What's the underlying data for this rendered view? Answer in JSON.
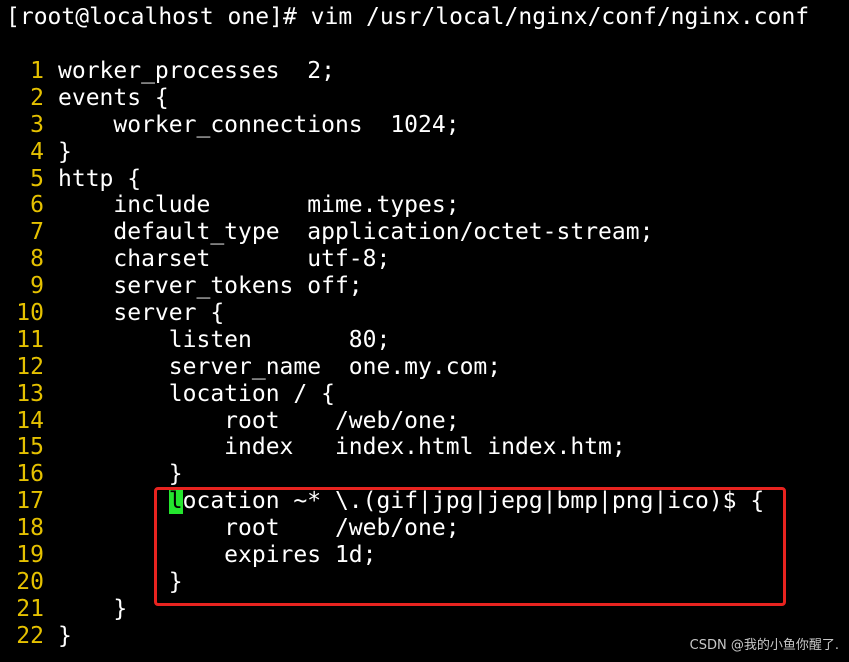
{
  "window": {
    "prompt": "[root@localhost one]# vim /usr/local/nginx/conf/nginx.conf"
  },
  "colors": {
    "background": "#000000",
    "text": "#ffffff",
    "line_number": "#e5c100",
    "cursor": "#24e62e",
    "highlight_box": "#e8231f"
  },
  "editor": {
    "lines": [
      {
        "num": "1",
        "text": "worker_processes  2;"
      },
      {
        "num": "2",
        "text": "events {"
      },
      {
        "num": "3",
        "text": "    worker_connections  1024;"
      },
      {
        "num": "4",
        "text": "}"
      },
      {
        "num": "5",
        "text": "http {"
      },
      {
        "num": "6",
        "text": "    include       mime.types;"
      },
      {
        "num": "7",
        "text": "    default_type  application/octet-stream;"
      },
      {
        "num": "8",
        "text": "    charset       utf-8;"
      },
      {
        "num": "9",
        "text": "    server_tokens off;"
      },
      {
        "num": "10",
        "text": "    server {"
      },
      {
        "num": "11",
        "text": "        listen       80;"
      },
      {
        "num": "12",
        "text": "        server_name  one.my.com;"
      },
      {
        "num": "13",
        "text": "        location / {"
      },
      {
        "num": "14",
        "text": "            root    /web/one;"
      },
      {
        "num": "15",
        "text": "            index   index.html index.htm;"
      },
      {
        "num": "16",
        "text": "        }"
      },
      {
        "num": "17",
        "indent": "        ",
        "cursor_char": "l",
        "rest": "ocation ~* \\.(gif|jpg|jepg|bmp|png|ico)$ {"
      },
      {
        "num": "18",
        "text": "            root    /web/one;"
      },
      {
        "num": "19",
        "text": "            expires 1d;"
      },
      {
        "num": "20",
        "text": "        }"
      },
      {
        "num": "21",
        "text": "    }"
      },
      {
        "num": "22",
        "text": "}"
      }
    ]
  },
  "watermark": "CSDN @我的小鱼你醒了."
}
